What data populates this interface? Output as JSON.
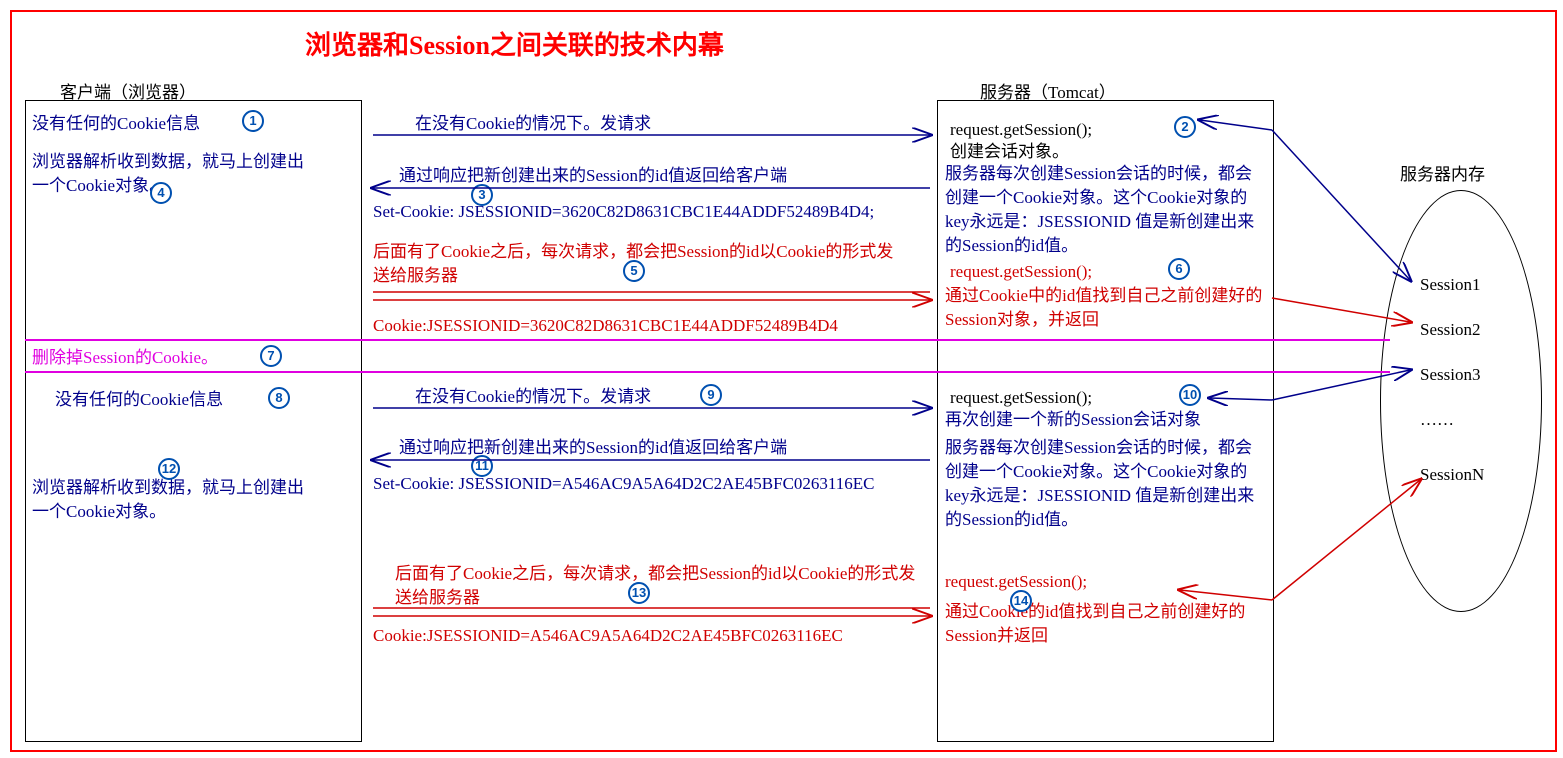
{
  "title": "浏览器和Session之间关联的技术内幕",
  "client_label": "客户端（浏览器）",
  "server_label": "服务器（Tomcat）",
  "memory_label": "服务器内存",
  "client": {
    "no_cookie_1": "没有任何的Cookie信息",
    "parse_create_1": "浏览器解析收到数据，就马上创建出一个Cookie对象。",
    "delete_cookie": "删除掉Session的Cookie。",
    "no_cookie_2": "没有任何的Cookie信息",
    "parse_create_2": "浏览器解析收到数据，就马上创建出一个Cookie对象。"
  },
  "flow": {
    "req_no_cookie_1": "在没有Cookie的情况下。发请求",
    "resp_session_id_1": "通过响应把新创建出来的Session的id值返回给客户端",
    "set_cookie_1": "Set-Cookie: JSESSIONID=3620C82D8631CBC1E44ADDF52489B4D4;",
    "after_cookie_1": "后面有了Cookie之后，每次请求，都会把Session的id以Cookie的形式发送给服务器",
    "cookie_header_1": "Cookie:JSESSIONID=3620C82D8631CBC1E44ADDF52489B4D4",
    "req_no_cookie_2": "在没有Cookie的情况下。发请求",
    "resp_session_id_2": "通过响应把新创建出来的Session的id值返回给客户端",
    "set_cookie_2": "Set-Cookie: JSESSIONID=A546AC9A5A64D2C2AE45BFC0263116EC",
    "after_cookie_2": "后面有了Cookie之后，每次请求，都会把Session的id以Cookie的形式发送给服务器",
    "cookie_header_2": "Cookie:JSESSIONID=A546AC9A5A64D2C2AE45BFC0263116EC"
  },
  "server": {
    "get_session_1": "request.getSession();",
    "create_session": "创建会话对象。",
    "every_create_1": "服务器每次创建Session会话的时候，都会创建一个Cookie对象。这个Cookie对象的key永远是：JSESSIONID 值是新创建出来的Session的id值。",
    "get_session_2": "request.getSession();",
    "find_by_cookie_1": "通过Cookie中的id值找到自己之前创建好的Session对象，并返回",
    "get_session_3": "request.getSession();",
    "recreate": "再次创建一个新的Session会话对象",
    "every_create_2": "服务器每次创建Session会话的时候，都会创建一个Cookie对象。这个Cookie对象的key永远是：JSESSIONID 值是新创建出来的Session的id值。",
    "get_session_4": "request.getSession();",
    "find_by_cookie_2": "通过Cookie的id值找到自己之前创建好的Session并返回"
  },
  "memory": {
    "s1": "Session1",
    "s2": "Session2",
    "s3": "Session3",
    "dots": "……",
    "sn": "SessionN"
  },
  "badges": {
    "b1": "1",
    "b2": "2",
    "b3": "3",
    "b4": "4",
    "b5": "5",
    "b6": "6",
    "b7": "7",
    "b8": "8",
    "b9": "9",
    "b10": "10",
    "b11": "11",
    "b12": "12",
    "b13": "13",
    "b14": "14"
  }
}
